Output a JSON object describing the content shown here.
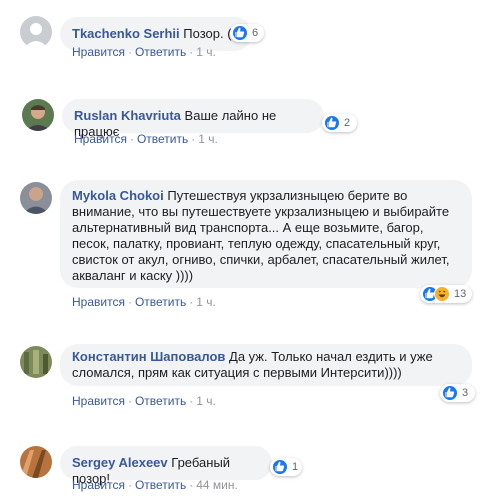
{
  "comments": [
    {
      "author": "Tkachenko Serhii",
      "text": "Позор. (",
      "reaction_count": "6",
      "reactions": [
        "like-icon"
      ],
      "actions": {
        "like": "Нравится",
        "reply": "Ответить",
        "time": "1 ч."
      }
    },
    {
      "author": "Ruslan Khavriuta",
      "text": "Ваше лайно не працює",
      "reaction_count": "2",
      "reactions": [
        "like-icon"
      ],
      "actions": {
        "like": "Нравится",
        "reply": "Ответить",
        "time": "1 ч."
      }
    },
    {
      "author": "Mykola Chokoi",
      "text": "Путешествуя укрзализныцею берите во внимание, что вы путешествуете укрзализныцею и выбирайте альтернативный вид транспорта... А еще возьмите, багор, песок, палатку, провиант, теплую одежду, спасательный круг, свисток от акул, огниво, спички, арбалет, спасательный жилет, акваланг и каску ))))",
      "reaction_count": "13",
      "reactions": [
        "like-icon",
        "haha-icon"
      ],
      "actions": {
        "like": "Нравится",
        "reply": "Ответить",
        "time": "1 ч."
      }
    },
    {
      "author": "Константин Шаповалов",
      "text": "Да уж. Только начал ездить и уже сломался, прям как ситуация с первыми Интерсити))))",
      "reaction_count": "3",
      "reactions": [
        "like-icon"
      ],
      "actions": {
        "like": "Нравится",
        "reply": "Ответить",
        "time": "1 ч."
      }
    },
    {
      "author": "Sergey Alexeev",
      "text": "Гребаный позор!",
      "reaction_count": "1",
      "reactions": [
        "like-icon"
      ],
      "actions": {
        "like": "Нравится",
        "reply": "Ответить",
        "time": "44 мин."
      }
    }
  ],
  "colors": {
    "author_link": "#385898",
    "bubble_bg": "#f2f3f5",
    "like_blue": "#1877f2",
    "haha_yellow": "#f7b125",
    "meta_grey": "#90949c"
  }
}
